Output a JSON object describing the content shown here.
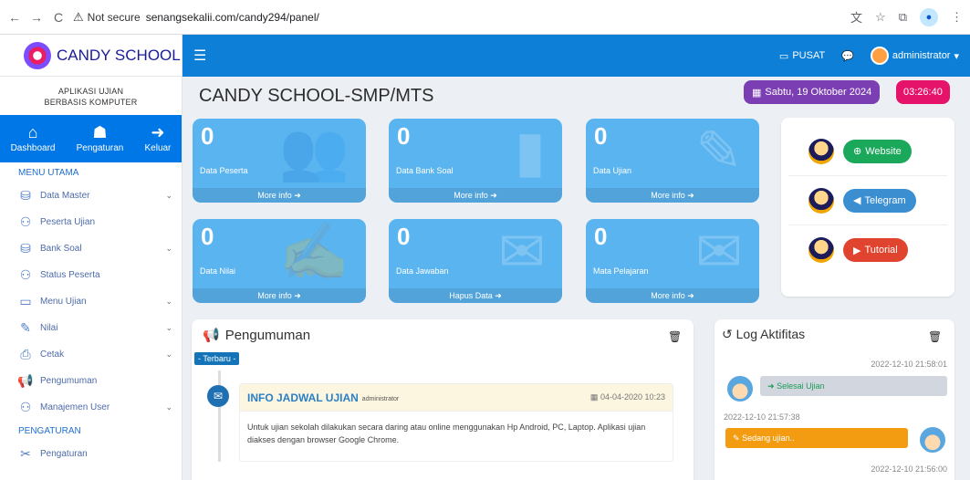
{
  "browser": {
    "back": "←",
    "forward": "→",
    "reload": "C",
    "security": "Not secure",
    "url": "senangsekalii.com/candy294/panel/"
  },
  "sidebar": {
    "brand": "CANDY SCHOOL",
    "subtitle_line1": "APLIKASI UJIAN",
    "subtitle_line2": "BERBASIS KOMPUTER",
    "quick": [
      {
        "label": "Dashboard",
        "icon": "home-icon"
      },
      {
        "label": "Pengaturan",
        "icon": "user-gear-icon"
      },
      {
        "label": "Keluar",
        "icon": "sign-out-icon"
      }
    ],
    "section_main": "MENU UTAMA",
    "items": [
      {
        "label": "Data Master",
        "icon": "database-icon",
        "has_sub": true
      },
      {
        "label": "Peserta Ujian",
        "icon": "users-icon",
        "has_sub": false
      },
      {
        "label": "Bank Soal",
        "icon": "database-icon",
        "has_sub": true
      },
      {
        "label": "Status Peserta",
        "icon": "users-icon",
        "has_sub": false
      },
      {
        "label": "Menu Ujian",
        "icon": "monitor-icon",
        "has_sub": true
      },
      {
        "label": "Nilai",
        "icon": "edit-icon",
        "has_sub": true
      },
      {
        "label": "Cetak",
        "icon": "print-icon",
        "has_sub": true
      },
      {
        "label": "Pengumuman",
        "icon": "megaphone-icon",
        "has_sub": false
      },
      {
        "label": "Manajemen User",
        "icon": "user-group-icon",
        "has_sub": true
      }
    ],
    "section_settings": "PENGATURAN",
    "settings_item": {
      "label": "Pengaturan",
      "icon": "tools-icon"
    }
  },
  "topbar": {
    "pusat": "PUSAT",
    "user": "administrator"
  },
  "page": {
    "title": "CANDY SCHOOL-SMP/MTS",
    "date": "Sabtu, 19 Oktober 2024",
    "time": "03:26:40"
  },
  "stats": [
    {
      "value": "0",
      "label": "Data Peserta",
      "link": "More info",
      "icon": "users-icon"
    },
    {
      "value": "0",
      "label": "Data Bank Soal",
      "link": "More info",
      "icon": "file-icon"
    },
    {
      "value": "0",
      "label": "Data Ujian",
      "link": "More info",
      "icon": "edit-icon"
    },
    {
      "value": "0",
      "label": "Data Nilai",
      "link": "More info",
      "icon": "file-signature-icon"
    },
    {
      "value": "0",
      "label": "Data Jawaban",
      "link": "Hapus Data",
      "icon": "envelope-icon"
    },
    {
      "value": "0",
      "label": "Mata Pelajaran",
      "link": "More info",
      "icon": "envelope-open-icon"
    }
  ],
  "links": [
    {
      "label": "Website",
      "color": "#1aa85b",
      "icon": "globe-icon"
    },
    {
      "label": "Telegram",
      "color": "#3b8fd1",
      "icon": "paper-plane-icon"
    },
    {
      "label": "Tutorial",
      "color": "#e0432e",
      "icon": "youtube-icon"
    }
  ],
  "announcement": {
    "header": "Pengumuman",
    "badge": "- Terbaru -",
    "title": "INFO JADWAL UJIAN",
    "author": "administrator",
    "date": "04-04-2020 10:23",
    "body": "Untuk ujian sekolah dilakukan secara daring atau online menggunakan Hp Android, PC, Laptop. Aplikasi ujian diakses dengan browser Google Chrome."
  },
  "log": {
    "header": "Log Aktifitas",
    "entries": [
      {
        "time": "2022-12-10 21:58:01",
        "text": "Selesai Ujian"
      },
      {
        "time": "2022-12-10 21:57:38",
        "text": "Sedang ujian.."
      },
      {
        "time": "2022-12-10 21:56:00",
        "text": ""
      }
    ]
  }
}
